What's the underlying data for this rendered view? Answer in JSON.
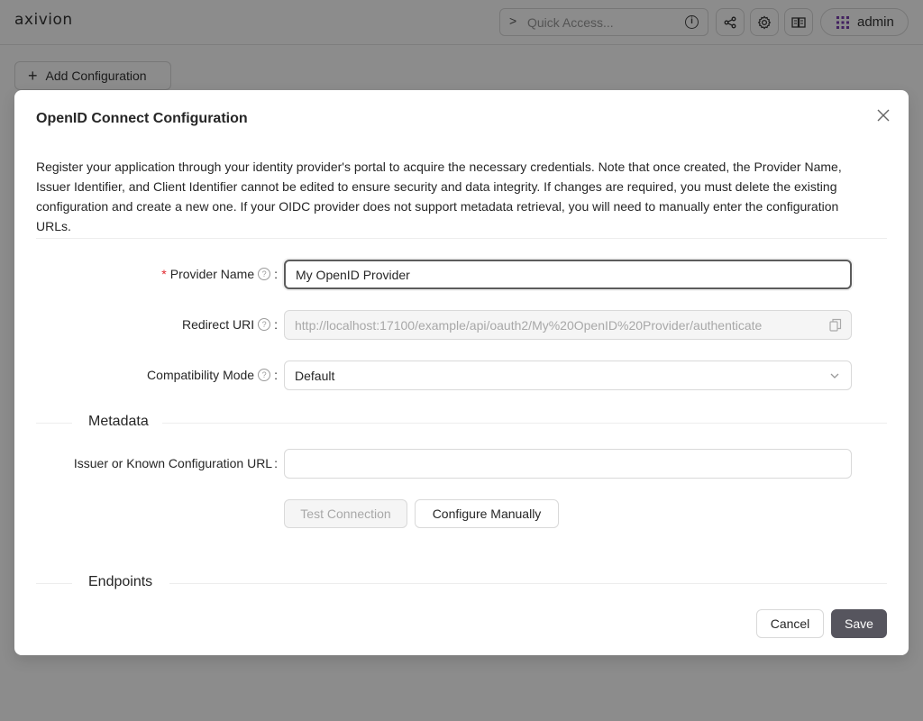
{
  "app": {
    "logo": "axivion",
    "quick_access_placeholder": "Quick Access...",
    "user_label": "admin",
    "add_config_label": "Add Configuration"
  },
  "modal": {
    "title": "OpenID Connect Configuration",
    "description": "Register your application through your identity provider's portal to acquire the necessary credentials. Note that once created, the Provider Name, Issuer Identifier, and Client Identifier cannot be edited to ensure security and data integrity. If changes are required, you must delete the existing configuration and create a new one. If your OIDC provider does not support metadata retrieval, you will need to manually enter the configuration URLs.",
    "fields": {
      "provider_name": {
        "label": "Provider Name",
        "required": true,
        "value": "My OpenID Provider"
      },
      "redirect_uri": {
        "label": "Redirect URI",
        "value": "http://localhost:17100/example/api/oauth2/My%20OpenID%20Provider/authenticate"
      },
      "compat_mode": {
        "label": "Compatibility Mode",
        "value": "Default"
      },
      "issuer_url": {
        "label": "Issuer or Known Configuration URL",
        "value": ""
      }
    },
    "sections": {
      "metadata": "Metadata",
      "endpoints": "Endpoints"
    },
    "buttons": {
      "test_connection": "Test Connection",
      "configure_manually": "Configure Manually",
      "cancel": "Cancel",
      "save": "Save"
    }
  },
  "colors": {
    "primary_button": "#56555e",
    "required_mark": "#e0282e",
    "logo_accent": "#7a3fb0"
  }
}
